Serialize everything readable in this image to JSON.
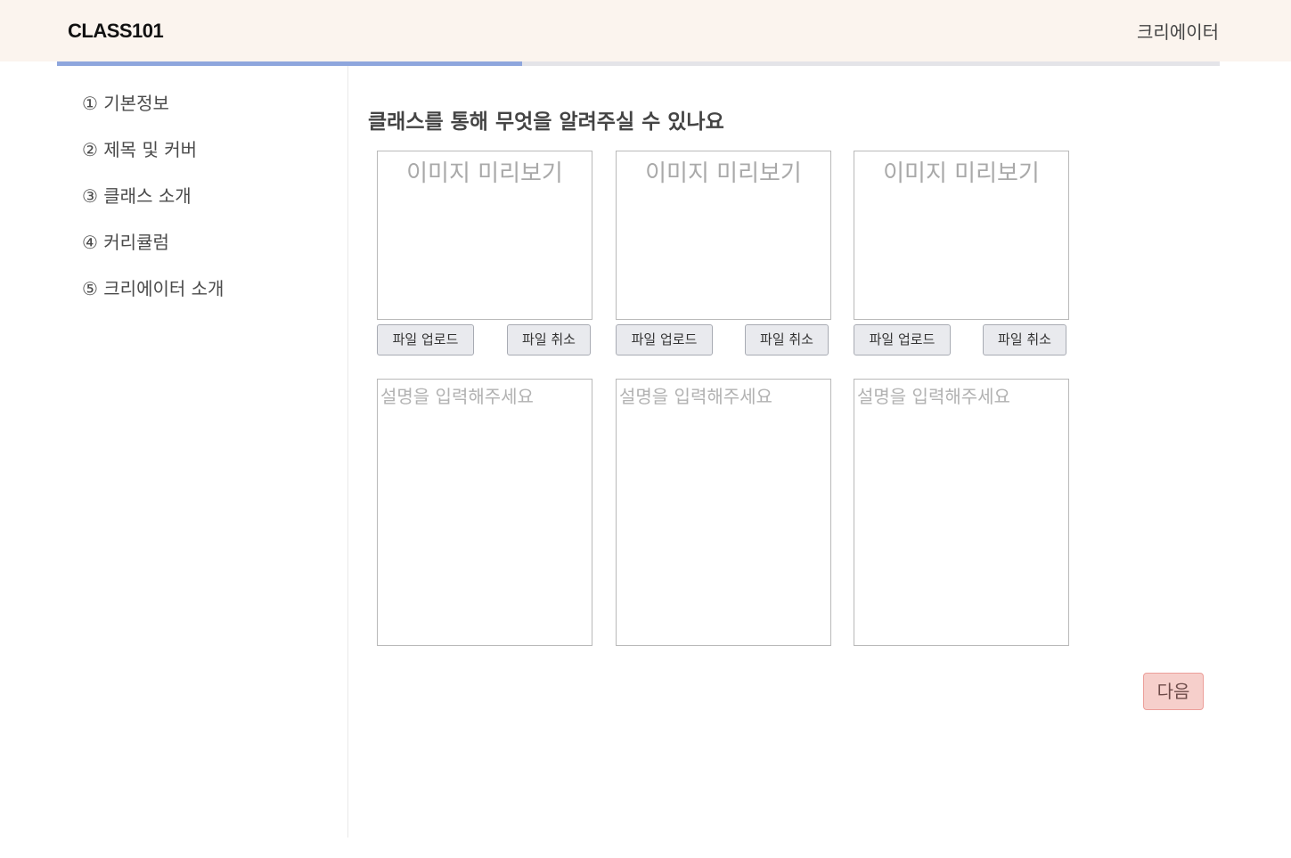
{
  "header": {
    "logo": "CLASS101",
    "creator_link": "크리에이터"
  },
  "progress": {
    "fraction": 0.4,
    "fill_color": "#8ea6dd",
    "track_color": "#e4e4e8"
  },
  "sidebar": {
    "steps": [
      {
        "label": "① 기본정보"
      },
      {
        "label": "② 제목 및 커버"
      },
      {
        "label": "③ 클래스 소개"
      },
      {
        "label": "④ 커리큘럼"
      },
      {
        "label": "⑤ 크리에이터 소개"
      }
    ]
  },
  "main": {
    "title": "클래스를 통해 무엇을 알려주실 수 있나요",
    "cards": [
      {
        "preview_text": "이미지 미리보기",
        "upload_label": "파일 업로드",
        "cancel_label": "파일 취소",
        "description_placeholder": "설명을 입력해주세요",
        "description_value": ""
      },
      {
        "preview_text": "이미지 미리보기",
        "upload_label": "파일 업로드",
        "cancel_label": "파일 취소",
        "description_placeholder": "설명을 입력해주세요",
        "description_value": ""
      },
      {
        "preview_text": "이미지 미리보기",
        "upload_label": "파일 업로드",
        "cancel_label": "파일 취소",
        "description_placeholder": "설명을 입력해주세요",
        "description_value": ""
      }
    ],
    "next_label": "다음"
  },
  "colors": {
    "header_bg": "#fbf4ee",
    "next_button_bg": "#f6cfcb",
    "next_button_border": "#ec9f9a"
  }
}
